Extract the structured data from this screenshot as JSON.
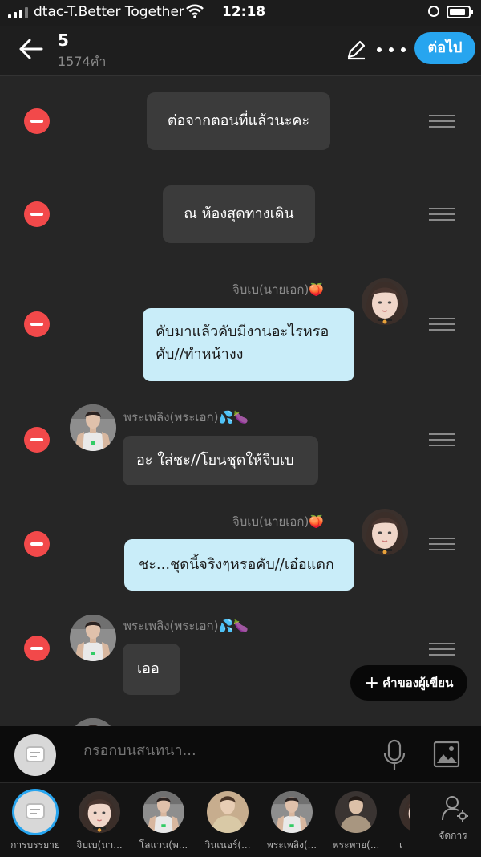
{
  "status_bar": {
    "carrier": "dtac-T.Better Together",
    "time": "12:18"
  },
  "header": {
    "title": "5",
    "subtitle": "1574คำ",
    "next_label": "ต่อไป"
  },
  "messages": [
    {
      "kind": "narration",
      "text": "ต่อจากตอนที่แล้วนะคะ"
    },
    {
      "kind": "narration",
      "text": "ณ ห้องสุดทางเดิน"
    },
    {
      "kind": "right",
      "sender": "จิบเบ(นายเอก)🍑",
      "lines": [
        "คับมาแล้วคับมีงานอะไรหรอ",
        "คับ//ทำหน้างง"
      ]
    },
    {
      "kind": "left",
      "sender": "พระเพลิง(พระเอก)💦🍆",
      "text": "อะ ใส่ชะ//โยนชุดให้จิบเบ"
    },
    {
      "kind": "right",
      "sender": "จิบเบ(นายเอก)🍑",
      "text": "ชะ...ชุดนี้จริงๆหรอคับ//เอ๋อแดก"
    },
    {
      "kind": "left",
      "sender": "พระเพลิง(พระเอก)💦🍆",
      "text": "เออ"
    }
  ],
  "writer_button_label": "คำของผู้เขียน",
  "composer": {
    "placeholder": "กรอกบนสนทนา..."
  },
  "characters": [
    {
      "name": "การบรรยาย"
    },
    {
      "name": "จิบเบ(นา..."
    },
    {
      "name": "โลแวน(พ..."
    },
    {
      "name": "วินเนอร์(..."
    },
    {
      "name": "พระเพลิง(..."
    },
    {
      "name": "พระพาย(..."
    },
    {
      "name": "เ"
    }
  ],
  "manage_label": "จัดการ",
  "colors": {
    "accent": "#27a5ef",
    "delete": "#f2494a",
    "light_bubble": "#c9edf9",
    "background": "#262626"
  }
}
